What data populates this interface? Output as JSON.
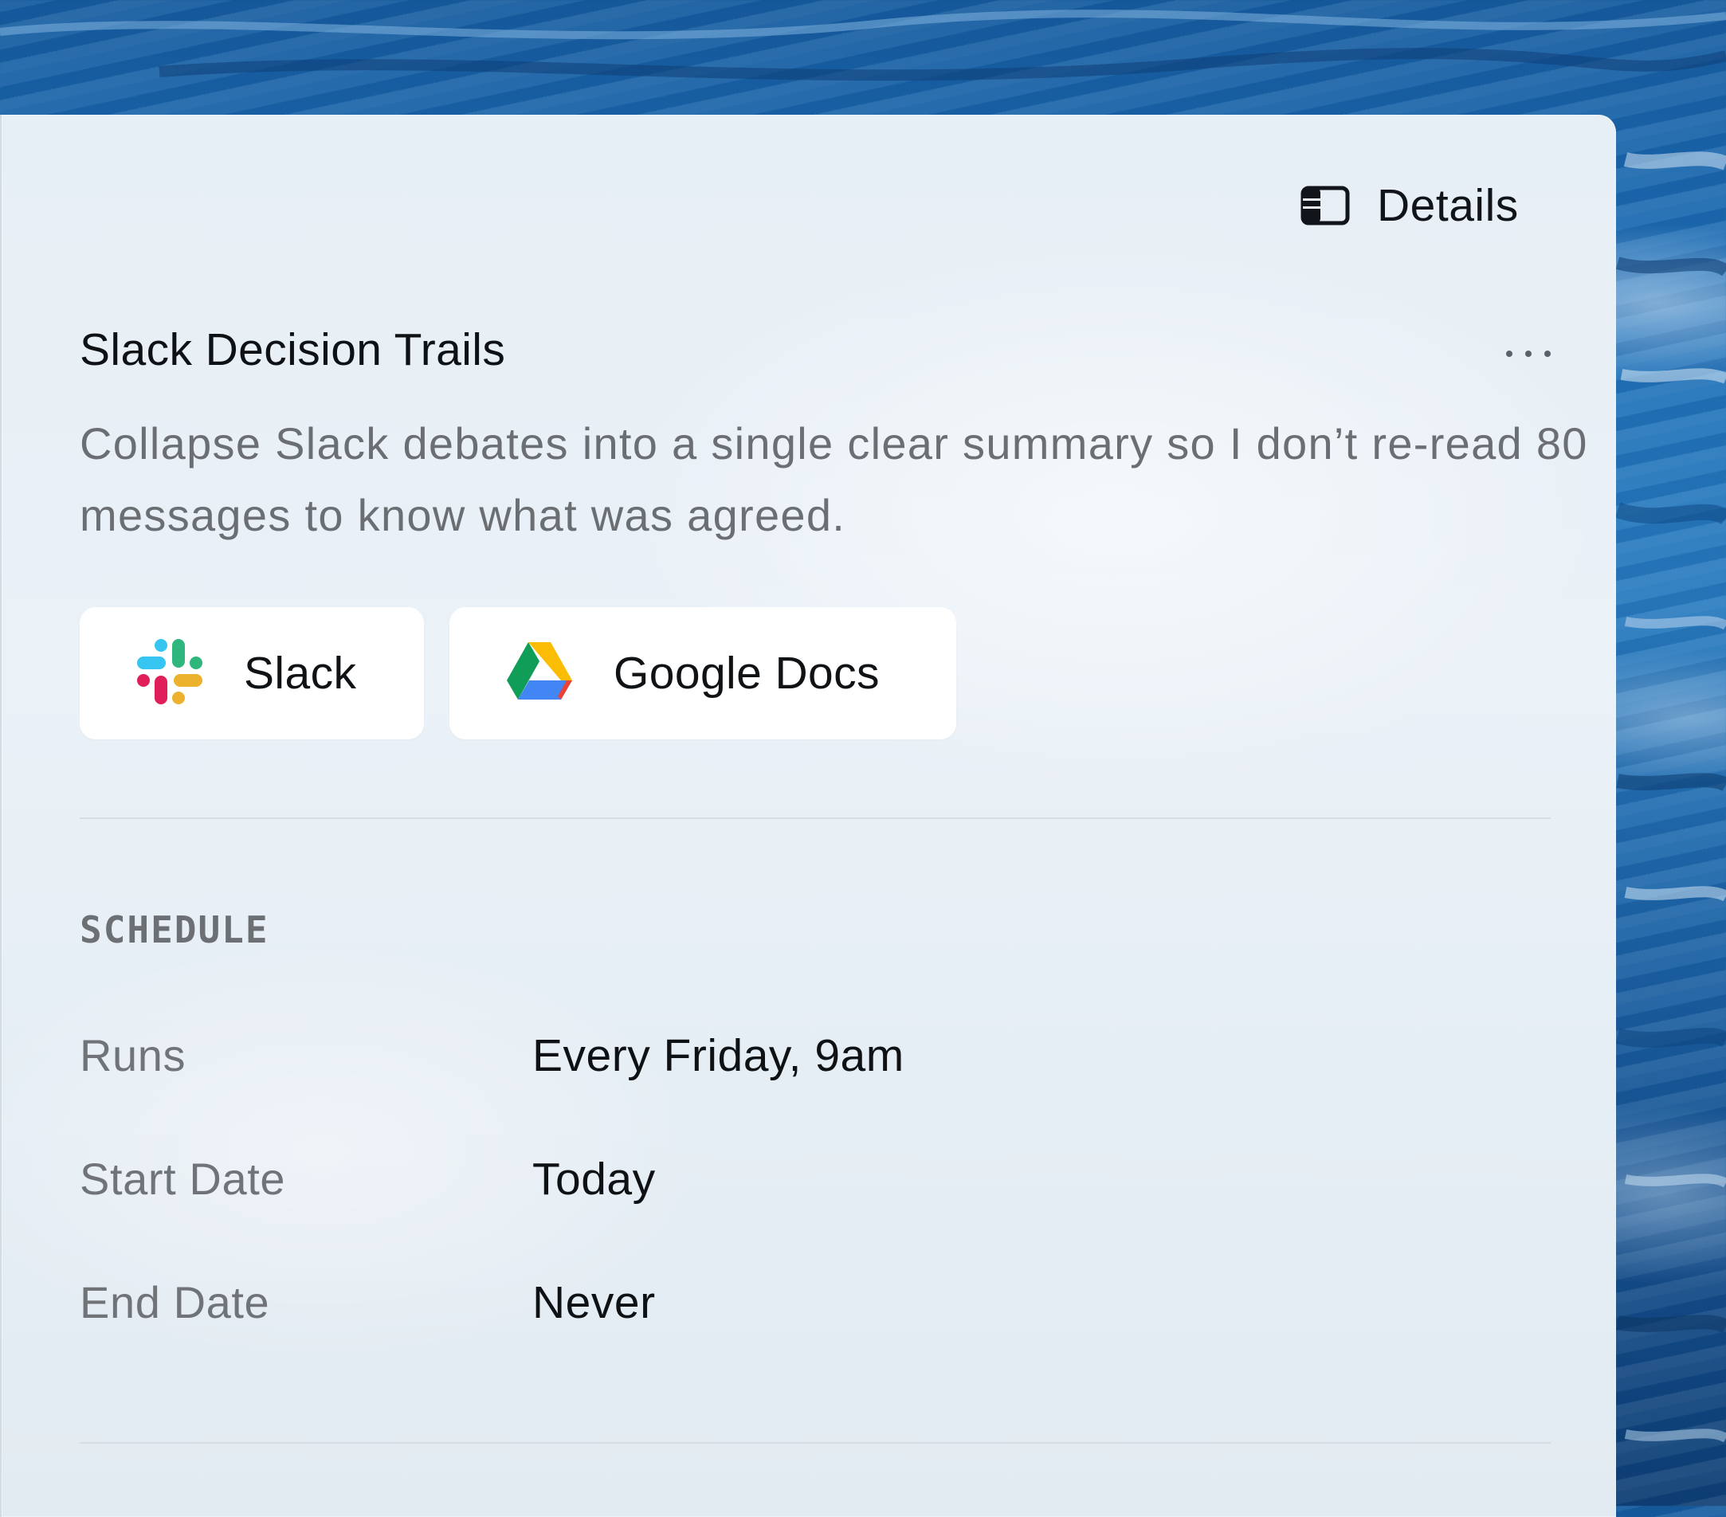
{
  "header": {
    "details_label": "Details",
    "details_icon": "sidebar-panel-icon"
  },
  "task": {
    "title": "Slack Decision Trails",
    "description": "Collapse Slack debates into a single clear summary so I don’t re-read 80 messages to know what was agreed.",
    "menu_icon": "more-horizontal-icon"
  },
  "integrations": [
    {
      "label": "Slack",
      "icon": "slack-logo-icon"
    },
    {
      "label": "Google Docs",
      "icon": "google-drive-logo-icon"
    }
  ],
  "schedule": {
    "section_label": "SCHEDULE",
    "rows": [
      {
        "label": "Runs",
        "value": "Every Friday, 9am"
      },
      {
        "label": "Start Date",
        "value": "Today"
      },
      {
        "label": "End Date",
        "value": "Never"
      }
    ]
  },
  "colors": {
    "background_blue": "#1f6fb6",
    "panel": "#e8f0f6",
    "text_primary": "#0f1215",
    "text_secondary": "#6b6f74",
    "chip_bg": "#ffffff"
  }
}
